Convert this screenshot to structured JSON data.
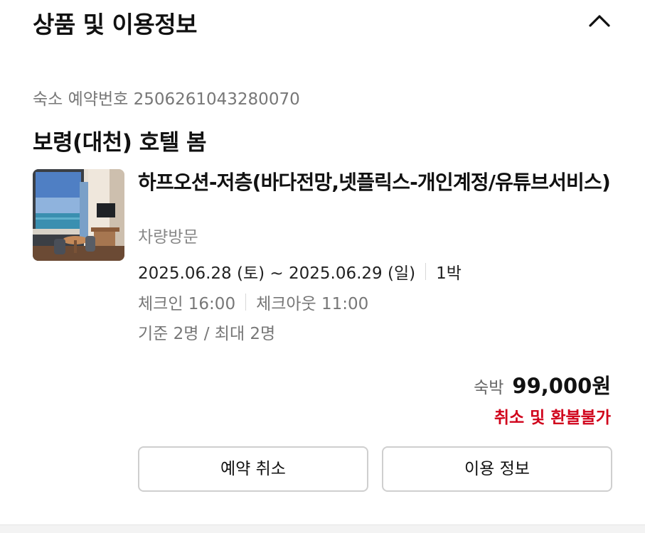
{
  "section": {
    "title": "상품 및 이용정보",
    "toggle_icon": "chevron-up-icon"
  },
  "reservation": {
    "number_label": "숙소 예약번호 2506261043280070"
  },
  "hotel": {
    "name": "보령(대천) 호텔 봄"
  },
  "room": {
    "image_icon": "room-photo",
    "name": "하프오션-저층(바다전망,넷플릭스-개인계정/유튜브서비스)",
    "visit_type": "차량방문",
    "dates": "2025.06.28 (토) ~ 2025.06.29 (일)",
    "nights": "1박",
    "checkin": "체크인 16:00",
    "checkout": "체크아웃 11:00",
    "capacity": "기준 2명 / 최대 2명"
  },
  "price": {
    "label": "숙박",
    "value": "99,000원",
    "refund_policy": "취소 및 환불불가",
    "refund_color": "#d0021b"
  },
  "actions": {
    "cancel_label": "예약 취소",
    "info_label": "이용 정보"
  }
}
